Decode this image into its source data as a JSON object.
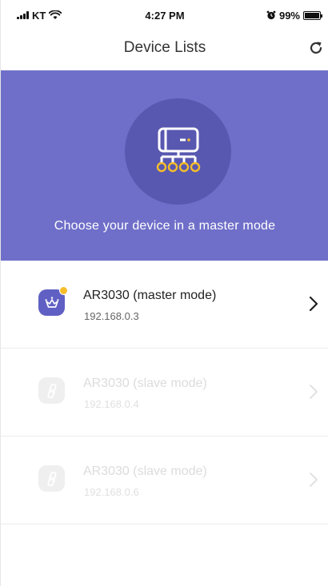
{
  "status_bar": {
    "carrier": "KT",
    "time": "4:27 PM",
    "battery": "99%",
    "battery_level": 0.99
  },
  "header": {
    "title": "Device Lists",
    "refresh_icon": "refresh-icon"
  },
  "banner": {
    "text": "Choose your device in a master mode",
    "icon": "network-hub-icon"
  },
  "devices": [
    {
      "name": "AR3030 (master mode)",
      "ip": "192.168.0.3",
      "mode": "master",
      "icon": "crown-icon"
    },
    {
      "name": "AR3030 (slave mode)",
      "ip": "192.168.0.4",
      "mode": "slave",
      "icon": "link-icon"
    },
    {
      "name": "AR3030 (slave mode)",
      "ip": "192.168.0.6",
      "mode": "slave",
      "icon": "link-icon"
    }
  ],
  "colors": {
    "banner": "#6f6fc9",
    "banner_circle": "#5858b1",
    "accent_dot": "#f5bd2a",
    "master_icon": "#6060c4"
  }
}
